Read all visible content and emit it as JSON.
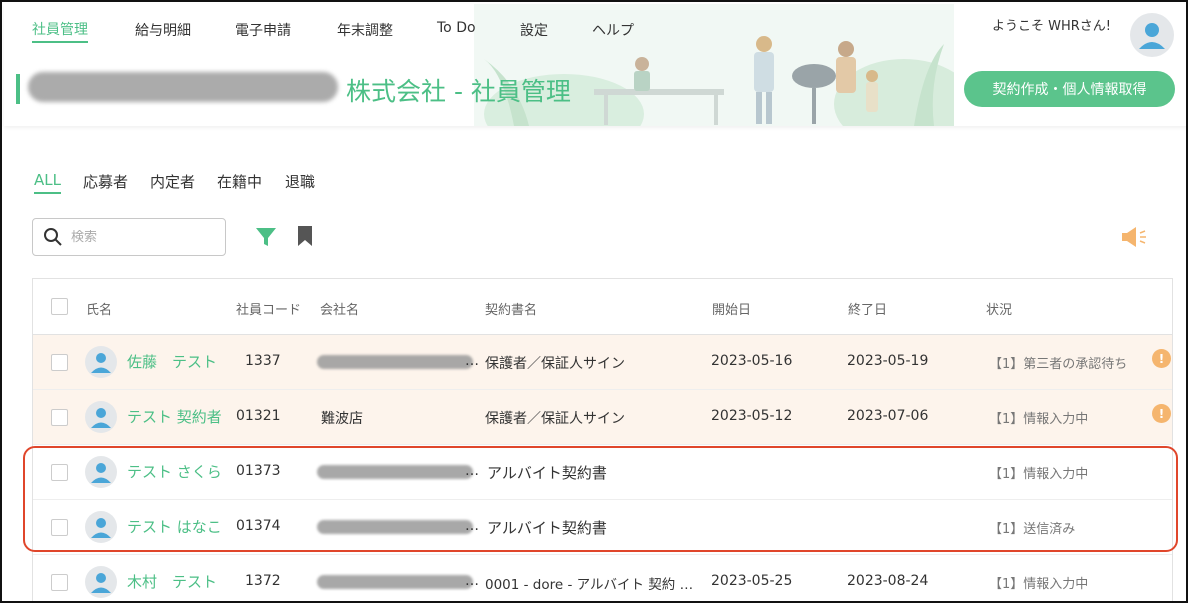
{
  "nav": {
    "items": [
      {
        "label": "社員管理",
        "active": true
      },
      {
        "label": "給与明細",
        "active": false
      },
      {
        "label": "電子申請",
        "active": false
      },
      {
        "label": "年末調整",
        "active": false
      },
      {
        "label": "To Do",
        "active": false
      },
      {
        "label": "設定",
        "active": false
      },
      {
        "label": "ヘルプ",
        "active": false
      }
    ],
    "welcome": "ようこそ WHRさん!"
  },
  "page": {
    "title_suffix": "株式会社 - 社員管理",
    "contract_button": "契約作成・個人情報取得"
  },
  "tabs": [
    {
      "label": "ALL",
      "active": true
    },
    {
      "label": "応募者",
      "active": false
    },
    {
      "label": "内定者",
      "active": false
    },
    {
      "label": "在籍中",
      "active": false
    },
    {
      "label": "退職",
      "active": false
    }
  ],
  "search": {
    "placeholder": "検索"
  },
  "table": {
    "headers": {
      "name": "氏名",
      "code": "社員コード",
      "company": "会社名",
      "contract": "契約書名",
      "start": "開始日",
      "end": "終了日",
      "status": "状況"
    },
    "rows": [
      {
        "name": "佐藤　テスト",
        "code": "1337",
        "company": "",
        "contract": "保護者／保証人サイン",
        "start": "2023-05-16",
        "end": "2023-05-19",
        "status": "【1】第三者の承認待ち",
        "warning": "!"
      },
      {
        "name": "テスト 契約者",
        "code": "01321",
        "company": "難波店",
        "contract": "保護者／保証人サイン",
        "start": "2023-05-12",
        "end": "2023-07-06",
        "status": "【1】情報入力中",
        "warning": "!"
      },
      {
        "name": "テスト さくら",
        "code": "01373",
        "company": "",
        "contract": "アルバイト契約書",
        "start": "",
        "end": "",
        "status": "【1】情報入力中",
        "warning": ""
      },
      {
        "name": "テスト はなこ",
        "code": "01374",
        "company": "",
        "contract": "アルバイト契約書",
        "start": "",
        "end": "",
        "status": "【1】送信済み",
        "warning": ""
      },
      {
        "name": "木村　テスト",
        "code": "1372",
        "company": "",
        "contract": "0001 - dore - アルバイト 契約 …",
        "start": "2023-05-25",
        "end": "2023-08-24",
        "status": "【1】情報入力中",
        "warning": ""
      }
    ]
  },
  "ellipsis": "…",
  "colors": {
    "accent": "#4cbf86",
    "pending_row": "#fdf4ec",
    "warning": "#f5b56e",
    "highlight": "#e0462b"
  }
}
